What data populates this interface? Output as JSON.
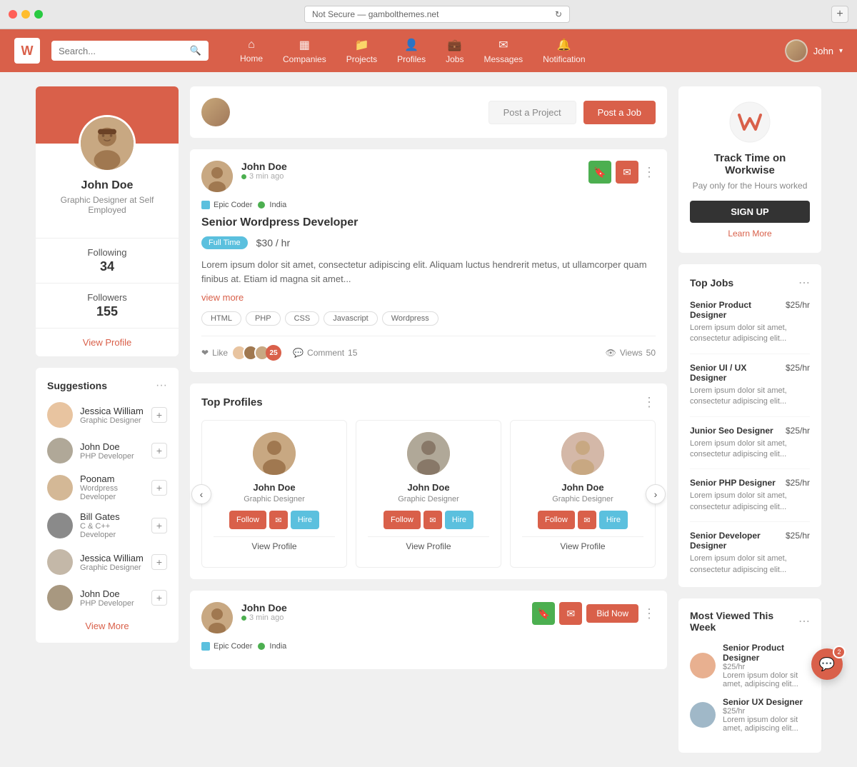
{
  "browser": {
    "address": "Not Secure — gambolthemes.net",
    "reload_icon": "↻"
  },
  "navbar": {
    "logo": "W",
    "search_placeholder": "Search...",
    "links": [
      {
        "label": "Home",
        "icon": "⌂"
      },
      {
        "label": "Companies",
        "icon": "▦"
      },
      {
        "label": "Projects",
        "icon": "📁"
      },
      {
        "label": "Profiles",
        "icon": "👤"
      },
      {
        "label": "Jobs",
        "icon": "💼"
      },
      {
        "label": "Messages",
        "icon": "✉"
      },
      {
        "label": "Notification",
        "icon": "🔔"
      }
    ],
    "user_name": "John",
    "dropdown_icon": "▾"
  },
  "sidebar_left": {
    "profile": {
      "name": "John Doe",
      "title": "Graphic Designer at Self Employed",
      "following_label": "Following",
      "following_count": "34",
      "followers_label": "Followers",
      "followers_count": "155",
      "view_profile": "View Profile"
    },
    "suggestions": {
      "title": "Suggestions",
      "items": [
        {
          "name": "Jessica William",
          "role": "Graphic Designer",
          "av": "av-1"
        },
        {
          "name": "John Doe",
          "role": "PHP Developer",
          "av": "av-2"
        },
        {
          "name": "Poonam",
          "role": "Wordpress Developer",
          "av": "av-3"
        },
        {
          "name": "Bill Gates",
          "role": "C & C++ Developer",
          "av": "av-4"
        },
        {
          "name": "Jessica William",
          "role": "Graphic Designer",
          "av": "av-5"
        },
        {
          "name": "John Doe",
          "role": "PHP Developer",
          "av": "av-6"
        }
      ],
      "view_more": "View More"
    }
  },
  "feed": {
    "compose": {
      "post_project": "Post a Project",
      "post_job": "Post a Job"
    },
    "job_post_1": {
      "user_name": "John Doe",
      "time": "3 min ago",
      "company": "Epic Coder",
      "location": "India",
      "job_title": "Senior Wordpress Developer",
      "badge": "Full Time",
      "rate": "$30 / hr",
      "desc": "Lorem ipsum dolor sit amet, consectetur adipiscing elit. Aliquam luctus hendrerit metus, ut ullamcorper quam finibus at. Etiam id magna sit amet...",
      "view_more": "view more",
      "tags": [
        "HTML",
        "PHP",
        "CSS",
        "Javascript",
        "Wordpress"
      ],
      "like_label": "Like",
      "like_count": "25",
      "comment_label": "Comment",
      "comment_count": "15",
      "views_label": "Views",
      "views_count": "50"
    },
    "top_profiles": {
      "title": "Top Profiles",
      "profiles": [
        {
          "name": "John Doe",
          "role": "Graphic Designer",
          "view_profile": "View Profile"
        },
        {
          "name": "John Doe",
          "role": "Graphic Designer",
          "view_profile": "View Profile"
        },
        {
          "name": "John Doe",
          "role": "Graphic Designer",
          "view_profile": "View Profile"
        }
      ],
      "follow_label": "Follow",
      "hire_label": "Hire"
    },
    "job_post_2": {
      "user_name": "John Doe",
      "time": "3 min ago",
      "company": "Epic Coder",
      "location": "India",
      "bid_label": "Bid Now"
    }
  },
  "sidebar_right": {
    "promo": {
      "title": "Track Time on Workwise",
      "subtitle": "Pay only for the Hours worked",
      "signup": "SIGN UP",
      "learn_more": "Learn More"
    },
    "top_jobs": {
      "title": "Top Jobs",
      "items": [
        {
          "title": "Senior Product Designer",
          "rate": "$25/hr",
          "desc": "Lorem ipsum dolor sit amet, consectetur adipiscing elit..."
        },
        {
          "title": "Senior UI / UX Designer",
          "rate": "$25/hr",
          "desc": "Lorem ipsum dolor sit amet, consectetur adipiscing elit..."
        },
        {
          "title": "Junior Seo Designer",
          "rate": "$25/hr",
          "desc": "Lorem ipsum dolor sit amet, consectetur adipiscing elit..."
        },
        {
          "title": "Senior PHP Designer",
          "rate": "$25/hr",
          "desc": "Lorem ipsum dolor sit amet, consectetur adipiscing elit..."
        },
        {
          "title": "Senior Developer Designer",
          "rate": "$25/hr",
          "desc": "Lorem ipsum dolor sit amet, consectetur adipiscing elit..."
        }
      ]
    },
    "most_viewed": {
      "title": "Most Viewed This Week",
      "items": [
        {
          "title": "Senior Product Designer",
          "rate": "$25/hr",
          "desc": "Lorem ipsum dolor sit amet, adipiscing elit..."
        },
        {
          "title": "Senior UX Designer",
          "rate": "$25/hr",
          "desc": "Lorem ipsum dolor sit amet, adipiscing elit..."
        }
      ]
    }
  },
  "chat_badge": "💬",
  "notification_count": "2"
}
